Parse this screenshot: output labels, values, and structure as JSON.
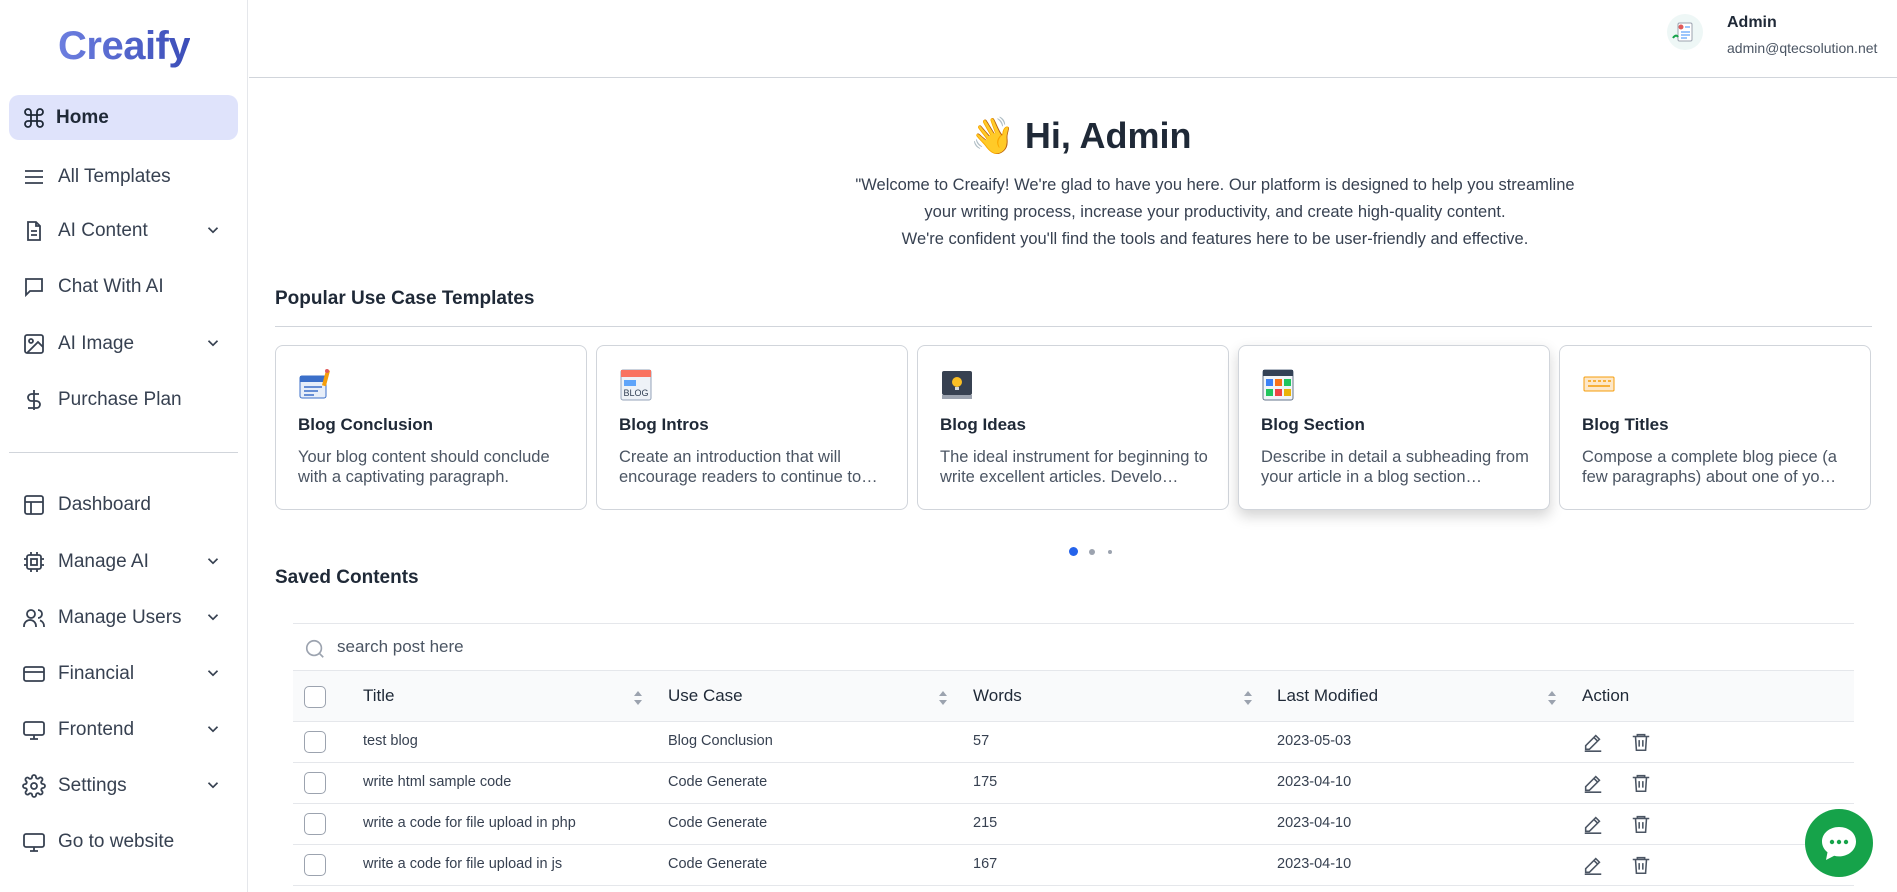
{
  "app": {
    "logo": "Creaify"
  },
  "sidebar": {
    "items": [
      {
        "label": "Home",
        "icon": "command-icon",
        "active": true
      },
      {
        "label": "All Templates",
        "icon": "menu-lines-icon"
      },
      {
        "label": "AI Content",
        "icon": "document-icon",
        "expandable": true
      },
      {
        "label": "Chat With AI",
        "icon": "chat-bubble-icon"
      },
      {
        "label": "AI Image",
        "icon": "image-icon",
        "expandable": true
      },
      {
        "label": "Purchase Plan",
        "icon": "dollar-icon"
      },
      {
        "label": "Dashboard",
        "icon": "layout-icon"
      },
      {
        "label": "Manage AI",
        "icon": "cpu-icon",
        "expandable": true
      },
      {
        "label": "Manage Users",
        "icon": "users-icon",
        "expandable": true
      },
      {
        "label": "Financial",
        "icon": "credit-card-icon",
        "expandable": true
      },
      {
        "label": "Frontend",
        "icon": "monitor-icon",
        "expandable": true
      },
      {
        "label": "Settings",
        "icon": "gear-icon",
        "expandable": true
      },
      {
        "label": "Go to website",
        "icon": "monitor-icon"
      }
    ]
  },
  "header": {
    "user_name": "Admin",
    "user_email": "admin@qtecsolution.net"
  },
  "hero": {
    "wave": "👋",
    "greeting": "Hi, Admin",
    "welcome_line1": "\"Welcome to Creaify! We're glad to have you here. Our platform is designed to help you streamline",
    "welcome_line2": "your writing process, increase your productivity, and create high-quality content.",
    "welcome_line3": "We're confident you'll find the tools and features here to be user-friendly and effective."
  },
  "templates": {
    "title": "Popular Use Case Templates",
    "cards": [
      {
        "title": "Blog Conclusion",
        "desc": "Your blog content should conclude with a captivating paragraph."
      },
      {
        "title": "Blog Intros",
        "desc": "Create an introduction that will encourage readers to continue to…"
      },
      {
        "title": "Blog Ideas",
        "desc": "The ideal instrument for beginning to write excellent articles. Develo…"
      },
      {
        "title": "Blog Section",
        "desc": "Describe in detail a subheading from your article in a blog section…"
      },
      {
        "title": "Blog Titles",
        "desc": "Compose a complete blog piece (a few paragraphs) about one of yo…"
      }
    ],
    "active_page": 0
  },
  "saved": {
    "title": "Saved Contents",
    "search_placeholder": "search post here",
    "columns": [
      "Title",
      "Use Case",
      "Words",
      "Last Modified",
      "Action"
    ],
    "rows": [
      {
        "title": "test blog",
        "use_case": "Blog Conclusion",
        "words": "57",
        "modified": "2023-05-03"
      },
      {
        "title": "write html sample code",
        "use_case": "Code Generate",
        "words": "175",
        "modified": "2023-04-10"
      },
      {
        "title": "write a code for file upload in php",
        "use_case": "Code Generate",
        "words": "215",
        "modified": "2023-04-10"
      },
      {
        "title": "write a code for file upload in js",
        "use_case": "Code Generate",
        "words": "167",
        "modified": "2023-04-10"
      }
    ]
  },
  "colors": {
    "accent": "#dfe3fb",
    "brand": "#4a5cc8",
    "chat": "#16a34a",
    "dot_active": "#2563eb"
  }
}
